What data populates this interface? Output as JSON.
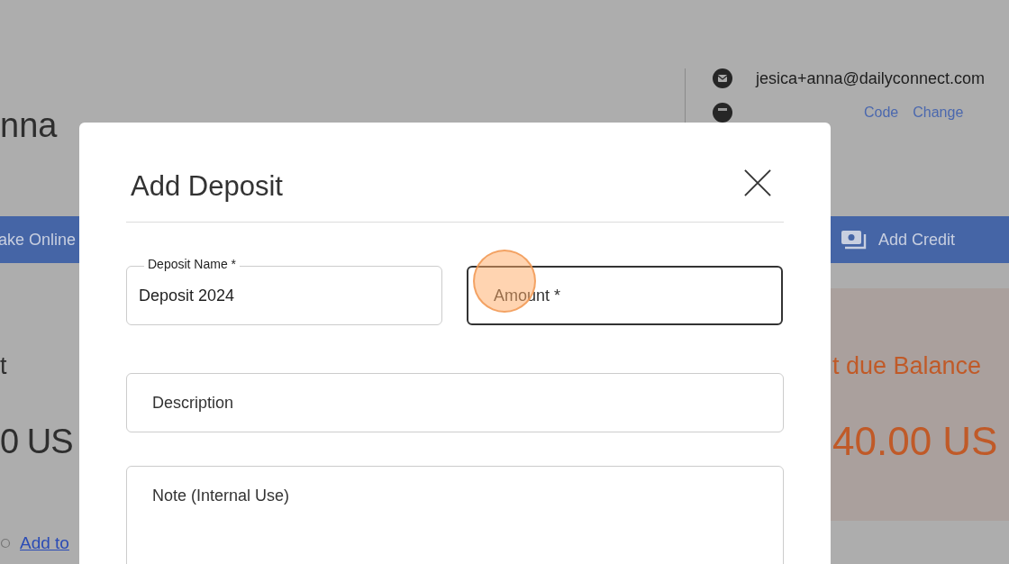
{
  "background": {
    "name_fragment": "nna",
    "contact": {
      "email": "jesica+anna@dailyconnect.com",
      "links": [
        "Code",
        "Change"
      ]
    },
    "action_bar": {
      "left_label": "ake Online",
      "right_button": "Add Credit"
    },
    "left_label": "t",
    "left_amount": "0 US",
    "balance": {
      "label": "t due Balance",
      "amount": "40.00 US"
    },
    "link": "Add to"
  },
  "dialog": {
    "title": "Add Deposit",
    "fields": [
      {
        "kind": "text",
        "label": "Deposit Name *",
        "value": "Deposit 2024",
        "focused": false
      },
      {
        "kind": "text",
        "placeholder": "Amount *",
        "focused": true
      },
      {
        "kind": "text",
        "placeholder": "Description",
        "focused": false
      },
      {
        "kind": "textarea",
        "placeholder": "Note (Internal Use)",
        "focused": false
      }
    ]
  }
}
